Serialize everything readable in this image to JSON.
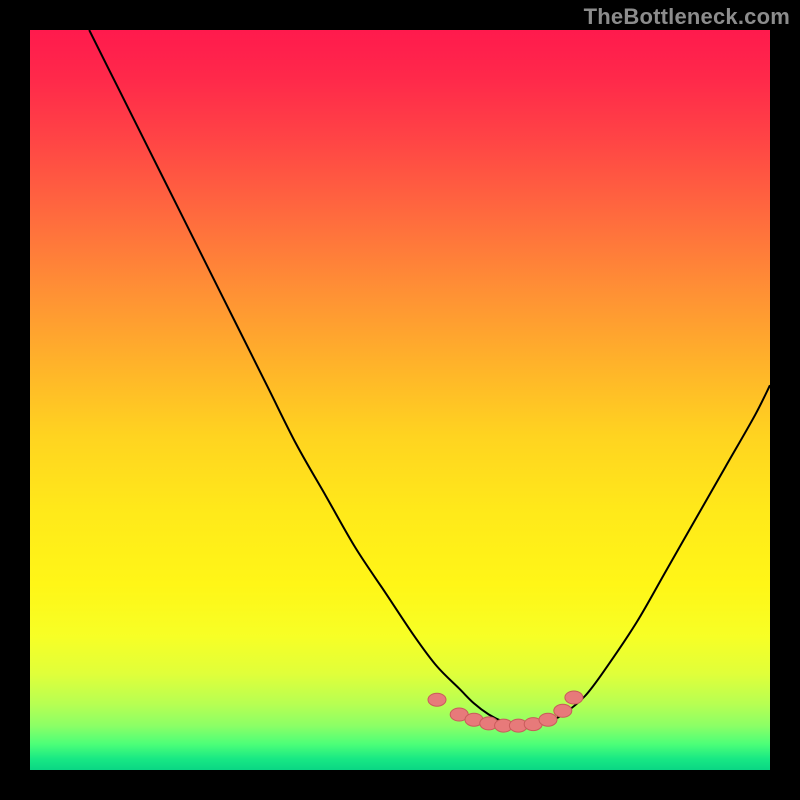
{
  "watermark": "TheBottleneck.com",
  "colors": {
    "bg": "#000000",
    "watermark": "#8c8c8c",
    "curve": "#000000",
    "markers_fill": "#e77a7a",
    "markers_stroke": "#c95b5b",
    "grad_stops": [
      {
        "offset": 0.0,
        "color": "#ff1a4d"
      },
      {
        "offset": 0.07,
        "color": "#ff2a4a"
      },
      {
        "offset": 0.15,
        "color": "#ff4545"
      },
      {
        "offset": 0.25,
        "color": "#ff6a3e"
      },
      {
        "offset": 0.35,
        "color": "#ff8f35"
      },
      {
        "offset": 0.45,
        "color": "#ffb22a"
      },
      {
        "offset": 0.55,
        "color": "#ffd420"
      },
      {
        "offset": 0.65,
        "color": "#ffe91a"
      },
      {
        "offset": 0.75,
        "color": "#fff617"
      },
      {
        "offset": 0.82,
        "color": "#f7ff26"
      },
      {
        "offset": 0.87,
        "color": "#e0ff3a"
      },
      {
        "offset": 0.91,
        "color": "#b8ff52"
      },
      {
        "offset": 0.94,
        "color": "#8cff66"
      },
      {
        "offset": 0.965,
        "color": "#4cff78"
      },
      {
        "offset": 0.985,
        "color": "#18e884"
      },
      {
        "offset": 1.0,
        "color": "#0ad684"
      }
    ]
  },
  "chart_data": {
    "type": "line",
    "title": "",
    "xlabel": "",
    "ylabel": "",
    "xlim": [
      0,
      100
    ],
    "ylim": [
      0,
      100
    ],
    "series": [
      {
        "name": "bottleneck-curve",
        "x": [
          8,
          12,
          16,
          20,
          24,
          28,
          32,
          36,
          40,
          44,
          48,
          52,
          55,
          58,
          60,
          62,
          64,
          66,
          68,
          70,
          72,
          75,
          78,
          82,
          86,
          90,
          94,
          98,
          100
        ],
        "y": [
          100,
          92,
          84,
          76,
          68,
          60,
          52,
          44,
          37,
          30,
          24,
          18,
          14,
          11,
          9,
          7.5,
          6.5,
          6,
          6,
          6.5,
          7.5,
          10,
          14,
          20,
          27,
          34,
          41,
          48,
          52
        ]
      }
    ],
    "markers": {
      "name": "bottom-cluster",
      "x": [
        55,
        58,
        60,
        62,
        64,
        66,
        68,
        70,
        72,
        73.5
      ],
      "y": [
        9.5,
        7.5,
        6.8,
        6.3,
        6.0,
        6.0,
        6.2,
        6.8,
        8.0,
        9.8
      ]
    }
  }
}
